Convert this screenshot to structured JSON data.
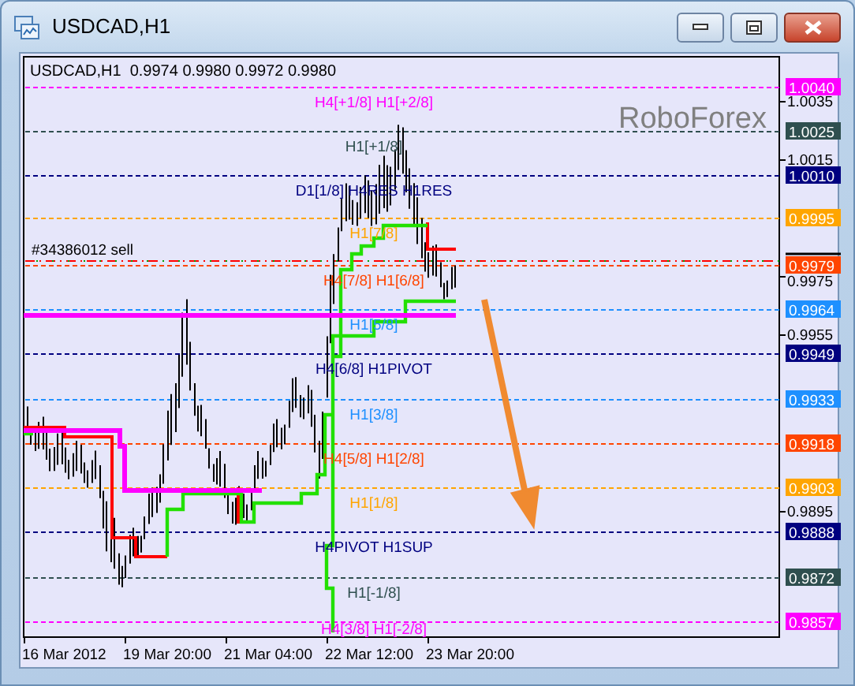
{
  "window": {
    "title": "USDCAD,H1"
  },
  "chart": {
    "header": "USDCAD,H1  0.9974 0.9980 0.9972 0.9980",
    "logo_text": "RoboForex",
    "order": {
      "label": "#34386012 sell"
    },
    "levels": [
      {
        "price": "1.0040",
        "label": "H4[+1/8] H1[+2/8]",
        "color": "#ff00ff"
      },
      {
        "price": "1.0025",
        "label": "H1[+1/8]",
        "color": "#2f4f4f"
      },
      {
        "price": "1.0010",
        "label": "D1[1/8] H4RES H1RES",
        "color": "#000080"
      },
      {
        "price": "0.9995",
        "label": "H1[7/8]",
        "color": "#ffa500"
      },
      {
        "price": "0.9979",
        "label": "H4[7/8] H1[6/8]",
        "color": "#ff4500"
      },
      {
        "price": "0.9964",
        "label": "H1[5/8]",
        "color": "#1e90ff"
      },
      {
        "price": "0.9949",
        "label": "H4[6/8] H1PIVOT",
        "color": "#000080"
      },
      {
        "price": "0.9933",
        "label": "H1[3/8]",
        "color": "#1e90ff"
      },
      {
        "price": "0.9918",
        "label": "H4[5/8] H1[2/8]",
        "color": "#ff4500"
      },
      {
        "price": "0.9903",
        "label": "H1[1/8]",
        "color": "#ffa500"
      },
      {
        "price": "0.9888",
        "label": "H4PIVOT H1SUP",
        "color": "#000080"
      },
      {
        "price": "0.9872",
        "label": "H1[-1/8]",
        "color": "#2f4f4f"
      },
      {
        "price": "0.9857",
        "label": "H4[3/8] H1[-2/8]",
        "color": "#ff00ff"
      }
    ],
    "price_ticks": [
      "1.0035",
      "1.0015",
      "0.9975",
      "0.9955",
      "0.9895"
    ],
    "time_labels": [
      "16 Mar 2012",
      "19 Mar 20:00",
      "21 Mar 04:00",
      "22 Mar 12:00",
      "23 Mar 20:00"
    ]
  }
}
